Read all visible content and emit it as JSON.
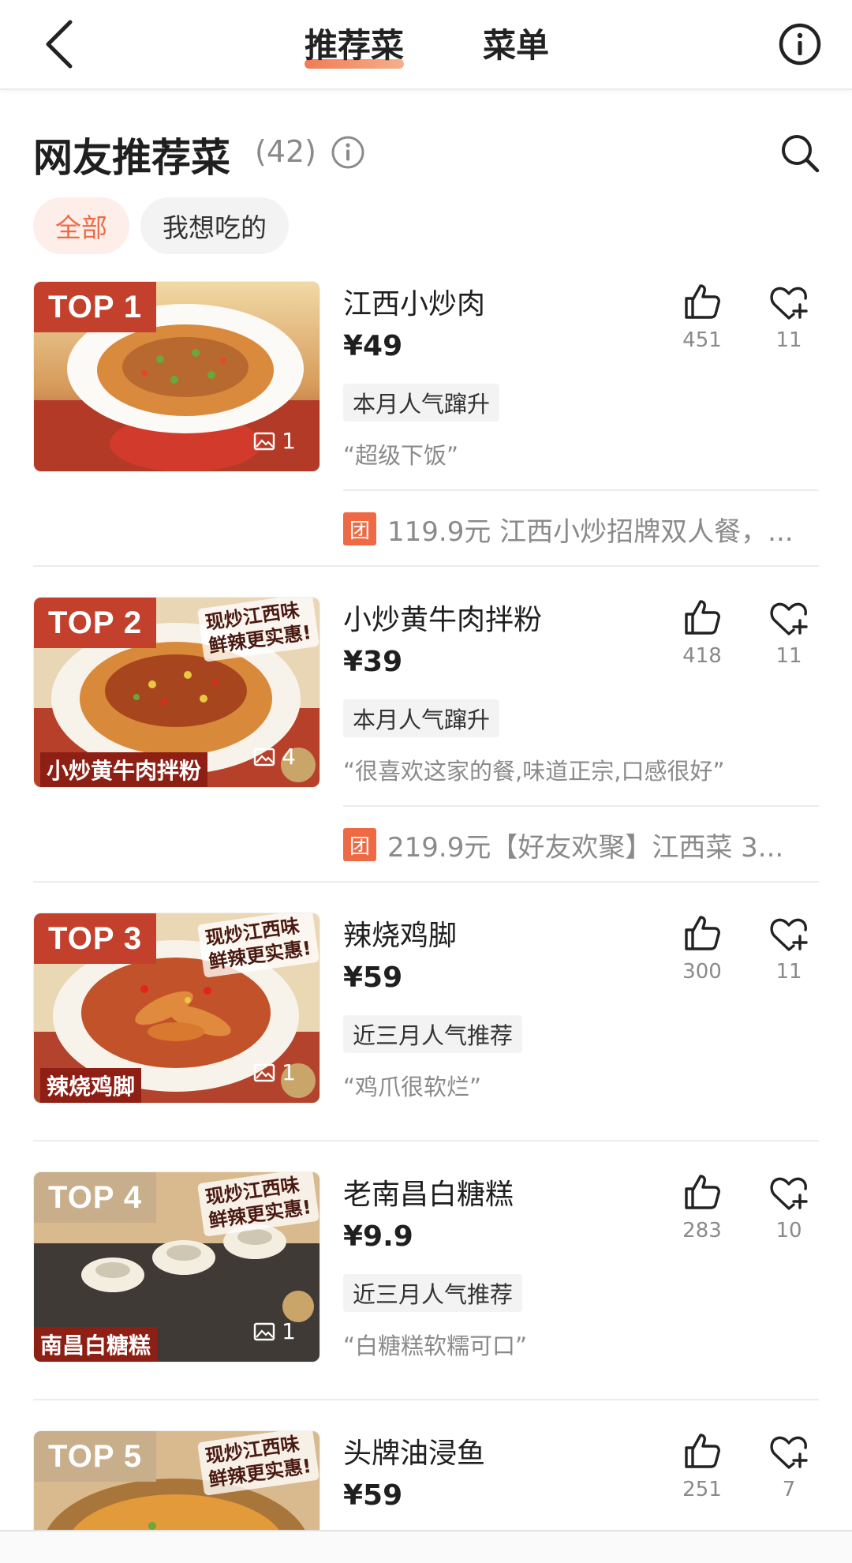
{
  "header": {
    "tab_recommend": "推荐菜",
    "tab_menu": "菜单"
  },
  "section": {
    "title": "网友推荐菜",
    "count": "(42)"
  },
  "filters": {
    "all": "全部",
    "want": "我想吃的"
  },
  "items": [
    {
      "rank": "TOP 1",
      "name": "江西小炒肉",
      "price": "¥49",
      "tag": "本月人气蹿升",
      "quote": "“超级下饭”",
      "likes": "451",
      "favs": "11",
      "image_count": "1",
      "deal": "119.9元 江西小炒招牌双人餐，..."
    },
    {
      "rank": "TOP 2",
      "name": "小炒黄牛肉拌粉",
      "price": "¥39",
      "tag": "本月人气蹿升",
      "quote": "“很喜欢这家的餐,味道正宗,口感很好”",
      "likes": "418",
      "favs": "11",
      "image_count": "4",
      "caption": "小炒黄牛肉拌粉",
      "stamp_line1": "现炒江西味",
      "stamp_line2": "鲜辣更实惠!",
      "deal": "219.9元【好友欢聚】江西菜 3..."
    },
    {
      "rank": "TOP 3",
      "name": "辣烧鸡脚",
      "price": "¥59",
      "tag": "近三月人气推荐",
      "quote": "“鸡爪很软烂”",
      "likes": "300",
      "favs": "11",
      "image_count": "1",
      "caption": "辣烧鸡脚",
      "stamp_line1": "现炒江西味",
      "stamp_line2": "鲜辣更实惠!"
    },
    {
      "rank": "TOP 4",
      "name": "老南昌白糖糕",
      "price": "¥9.9",
      "tag": "近三月人气推荐",
      "quote": "“白糖糕软糯可口”",
      "likes": "283",
      "favs": "10",
      "image_count": "1",
      "caption": "南昌白糖糕",
      "stamp_line1": "现炒江西味",
      "stamp_line2": "鲜辣更实惠!"
    },
    {
      "rank": "TOP 5",
      "name": "头牌油浸鱼",
      "price": "¥59",
      "likes": "251",
      "favs": "7",
      "stamp_line1": "现炒江西味",
      "stamp_line2": "鲜辣更实惠!"
    }
  ],
  "deal_badge": "团",
  "colors": {
    "accent": "#ef6b48",
    "badge_red": "#c3402d",
    "badge_tan": "#c8ae8b",
    "deal_badge": "#ed6a45"
  }
}
